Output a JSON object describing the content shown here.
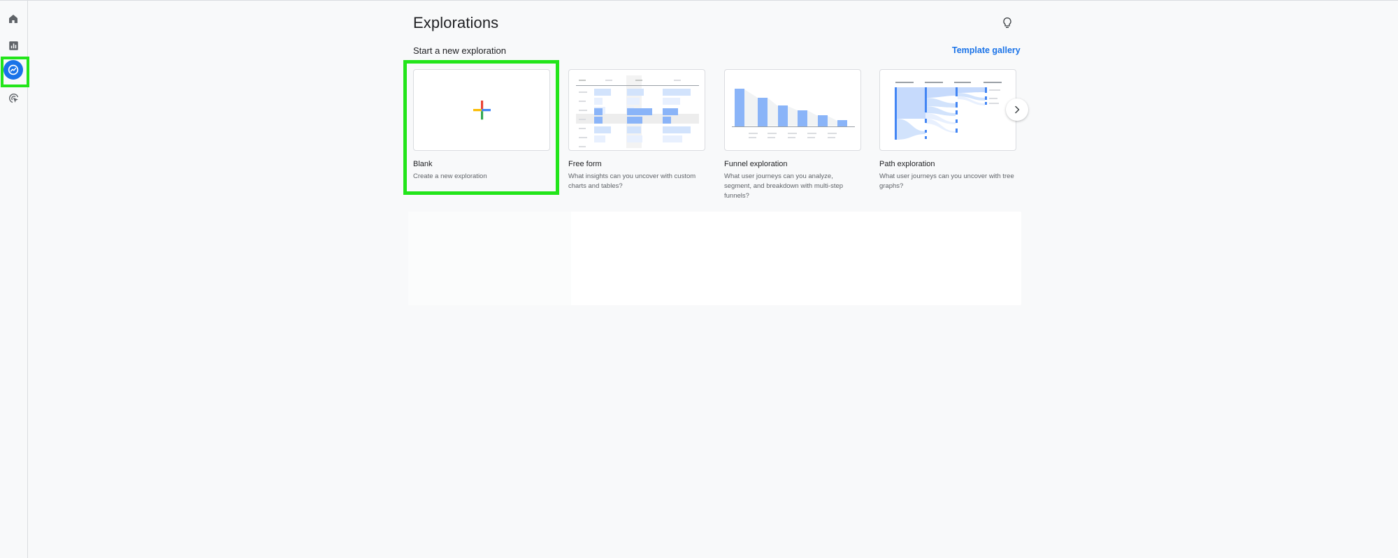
{
  "page": {
    "title": "Explorations",
    "section_label": "Start a new exploration",
    "template_gallery_label": "Template gallery"
  },
  "rail": {
    "items": [
      {
        "name": "Home",
        "icon": "home-icon"
      },
      {
        "name": "Reports",
        "icon": "reports-icon"
      },
      {
        "name": "Explore",
        "icon": "explore-icon",
        "active": true
      },
      {
        "name": "Advertising",
        "icon": "advertising-icon"
      }
    ]
  },
  "cards": [
    {
      "title": "Blank",
      "description": "Create a new exploration",
      "thumbnail": "plus-icon"
    },
    {
      "title": "Free form",
      "description": "What insights can you uncover with custom charts and tables?",
      "thumbnail": "free-form-preview"
    },
    {
      "title": "Funnel exploration",
      "description": "What user journeys can you analyze, segment, and breakdown with multi-step funnels?",
      "thumbnail": "funnel-preview"
    },
    {
      "title": "Path exploration",
      "description": "What user journeys can you uncover with tree graphs?",
      "thumbnail": "path-preview"
    }
  ],
  "colors": {
    "accent": "#1a73e8",
    "highlight": "#22e51a",
    "google_red": "#ea4335",
    "google_yellow": "#fbbc04",
    "google_green": "#34a853",
    "google_blue": "#4285f4",
    "preview_blue": "#8ab4f8"
  }
}
